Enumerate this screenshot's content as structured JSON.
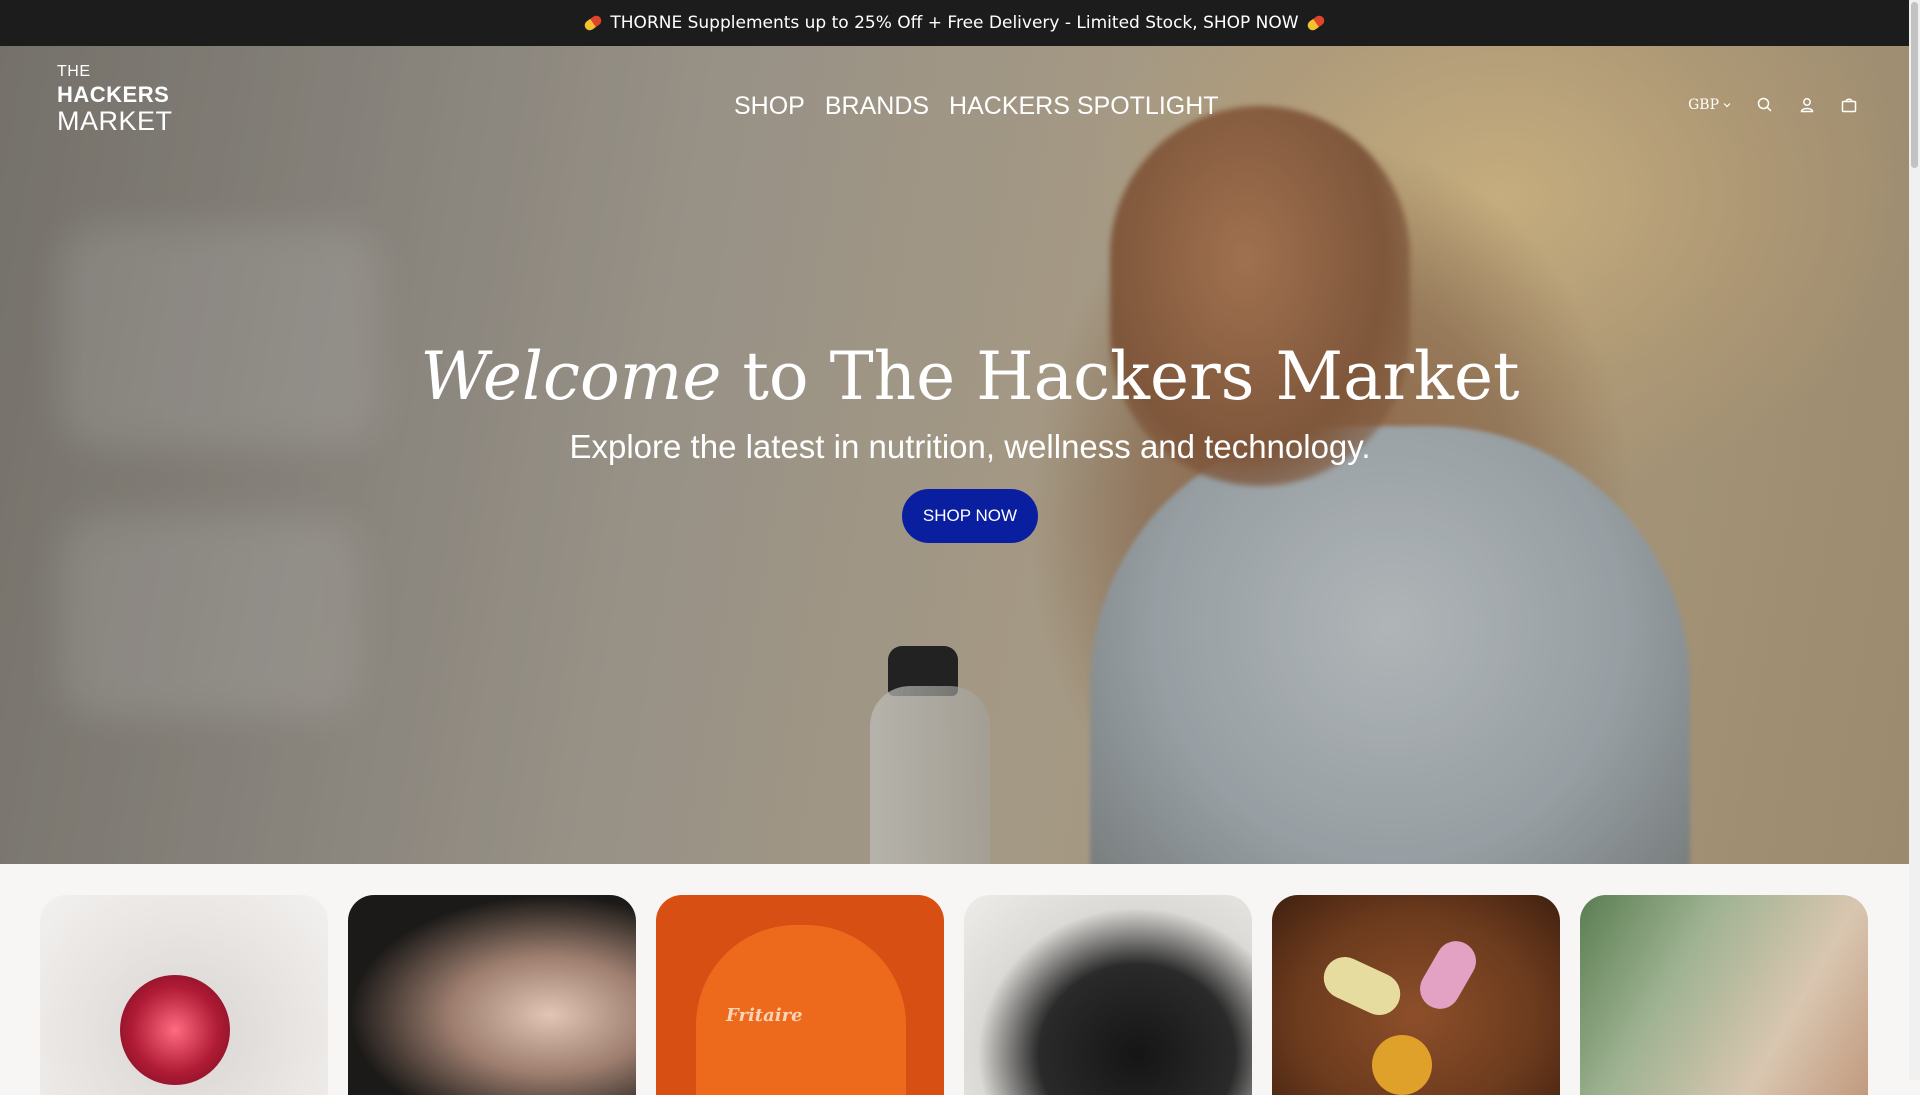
{
  "announcement": {
    "text": "THORNE Supplements up to 25% Off + Free Delivery - Limited Stock, SHOP NOW",
    "icon": "pill-icon"
  },
  "logo": {
    "line1": "THE",
    "line2": "HACKERS",
    "line3": "MARKET"
  },
  "nav": {
    "items": [
      {
        "label": "SHOP"
      },
      {
        "label": "BRANDS"
      },
      {
        "label": "HACKERS SPOTLIGHT"
      }
    ]
  },
  "header_tools": {
    "currency": "GBP",
    "icons": [
      "search-icon",
      "account-icon",
      "cart-icon"
    ]
  },
  "hero": {
    "title_italic": "Welcome",
    "title_rest": "to The Hackers Market",
    "subtitle": "Explore the latest in nutrition, wellness and technology.",
    "cta_label": "SHOP NOW",
    "cta_color": "#0a1fa0"
  },
  "tiles": {
    "brand_text": "Fritaire"
  },
  "colors": {
    "announcement_bg": "#1c1c1c",
    "page_bg": "#f7f6f4"
  }
}
